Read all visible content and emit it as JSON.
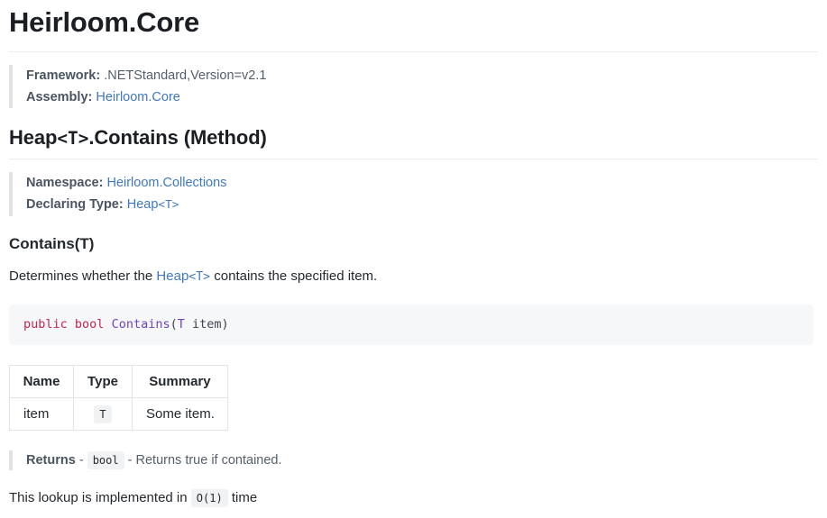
{
  "page": {
    "title": "Heirloom.Core"
  },
  "assembly_info": {
    "framework_label": "Framework:",
    "framework_value": ".NETStandard,Version=v2.1",
    "assembly_label": "Assembly:",
    "assembly_link": "Heirloom.Core"
  },
  "member": {
    "title_prefix": "Heap",
    "title_generic": "<T>",
    "title_suffix": ".Contains (Method)",
    "namespace_label": "Namespace:",
    "namespace_link": "Heirloom.Collections",
    "declaring_type_label": "Declaring Type:",
    "declaring_type_prefix": "Heap",
    "declaring_type_generic": "<T>"
  },
  "overload": {
    "heading": "Contains(T)",
    "summary_before": "Determines whether the ",
    "summary_link_prefix": "Heap",
    "summary_link_generic": "<T>",
    "summary_after": " contains the specified item."
  },
  "signature": {
    "keyword_public": "public",
    "keyword_bool": "bool",
    "method_name": "Contains",
    "open_paren": "(",
    "param_type": "T",
    "space": " ",
    "param_name": "item",
    "close_paren": ")"
  },
  "parameters_table": {
    "headers": [
      "Name",
      "Type",
      "Summary"
    ],
    "rows": [
      {
        "name": "item",
        "type": "T",
        "summary": "Some item."
      }
    ]
  },
  "returns": {
    "label": "Returns",
    "dash1": "-",
    "type": "bool",
    "dash2": "-",
    "description": "Returns true if contained."
  },
  "remarks": {
    "before": "This lookup is implemented in ",
    "code": "O(1)",
    "after": " time"
  },
  "colors": {
    "link": "#4078c0",
    "keyword": "#c7254e",
    "method": "#6f42c1",
    "code_background": "#f6f7f9",
    "chip_background": "#f1f2f4",
    "rule": "#eaecef",
    "quote_bar": "#dfe2e5",
    "text": "#24292e",
    "muted": "#56606a"
  }
}
